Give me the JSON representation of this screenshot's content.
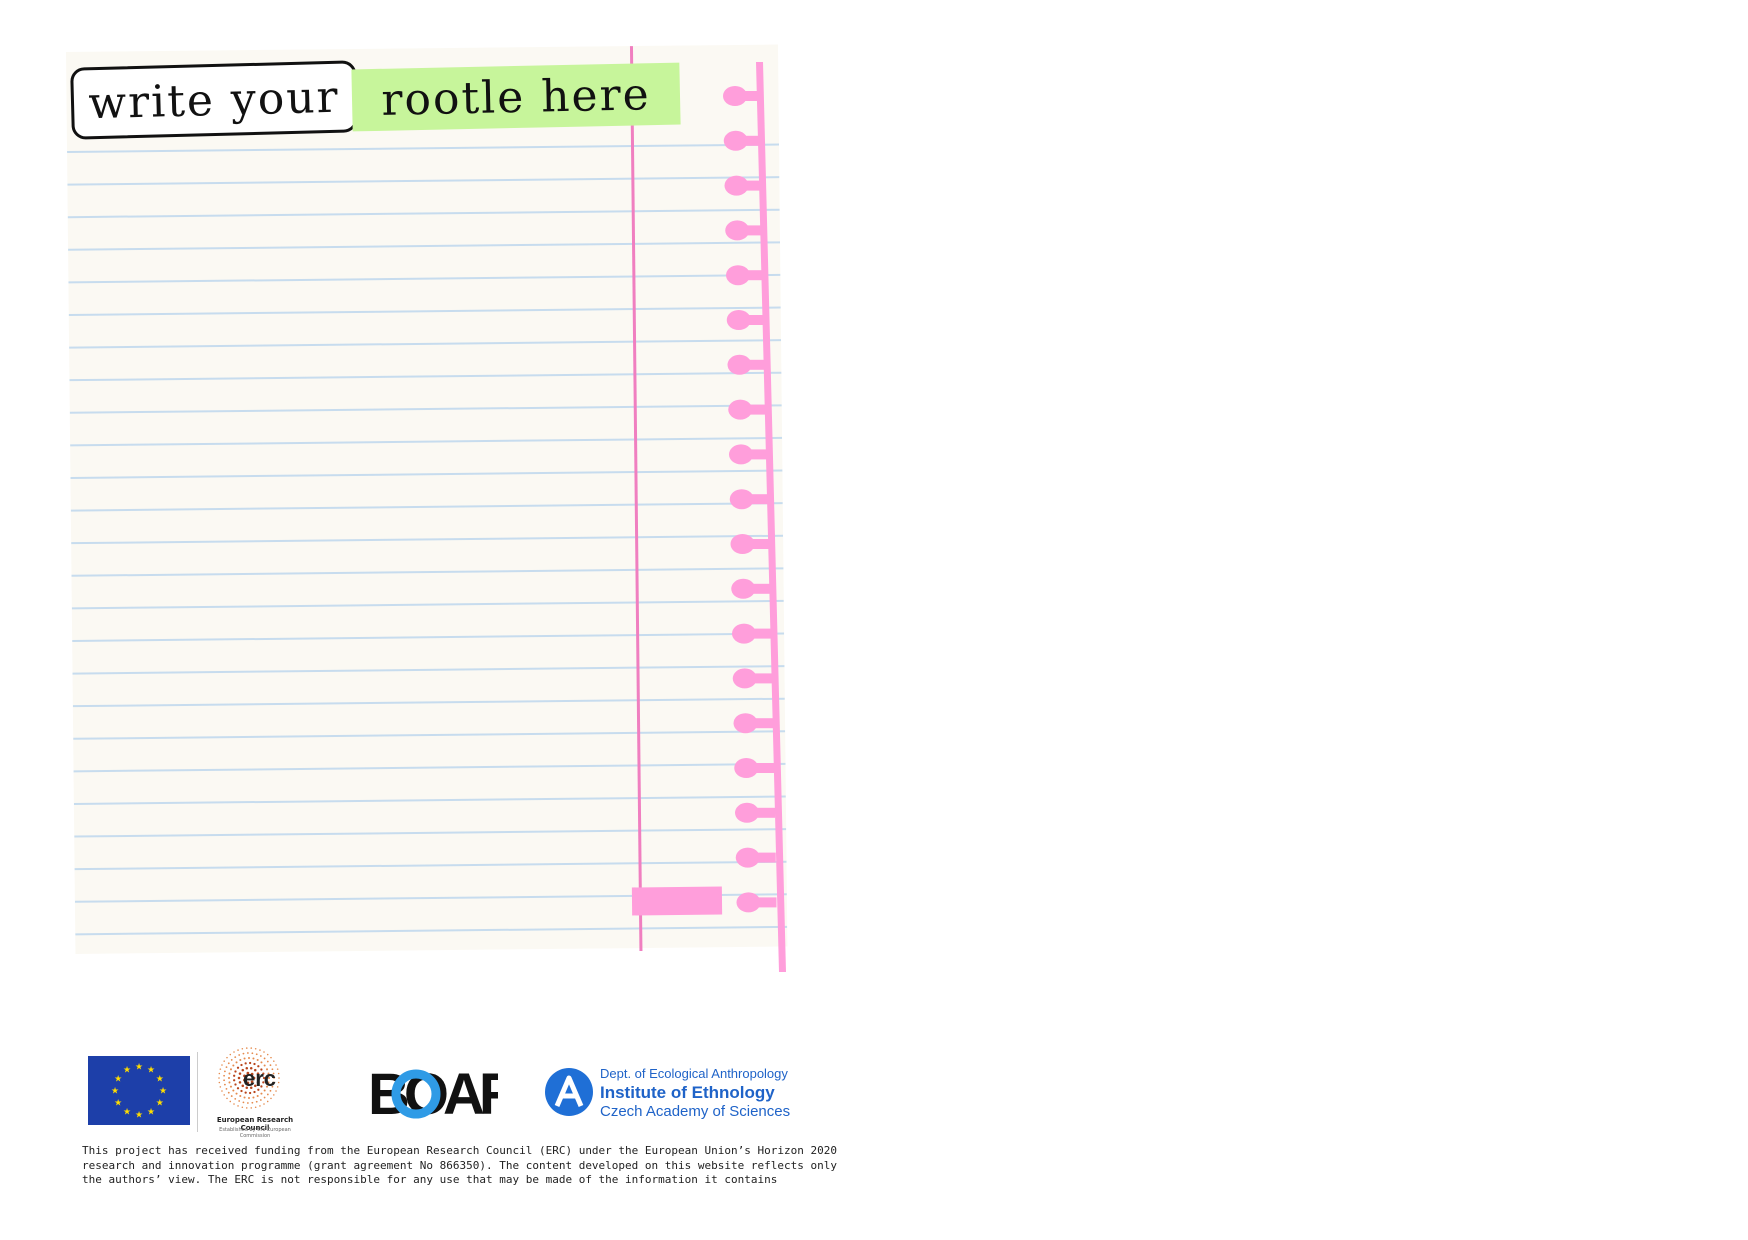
{
  "title": {
    "boxed": "write your",
    "highlighted": "rootle here"
  },
  "colors": {
    "paper": "#fbf9f3",
    "ruled_line": "#c7dcee",
    "margin_line": "#f07fc0",
    "ring_pink": "#ff9edb",
    "highlight": "#c7f59b",
    "eu_blue": "#1d3fa9",
    "eu_star": "#ffdd00",
    "institute_blue": "#1f63c8"
  },
  "logos": {
    "eu_flag": "eu-flag-icon",
    "erc": {
      "mark": "erc",
      "name": "European Research Council",
      "subline": "Established by the European Commission"
    },
    "boar": "BOAR",
    "institute": {
      "line1": "Dept. of Ecological Anthropology",
      "line2": "Institute of Ethnology",
      "line3": "Czech Academy of Sciences"
    }
  },
  "funding_text": "This project has received funding from the European Research Council (ERC) under the European Union’s Horizon 2020 research and innovation programme (grant agreement No 866350). The content developed on this website reflects only the authors’ view. The ERC is not responsible for any use that may be made of the information it contains"
}
